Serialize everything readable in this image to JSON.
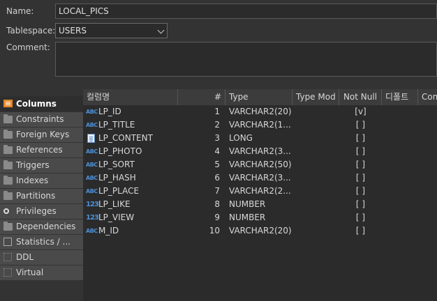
{
  "form": {
    "name_label": "Name:",
    "name_value": "LOCAL_PICS",
    "tablespace_label": "Tablespace:",
    "tablespace_value": "USERS",
    "comment_label": "Comment:",
    "comment_value": ""
  },
  "tabs": [
    {
      "label": "Columns",
      "icon": "columns-icon",
      "active": true
    },
    {
      "label": "Constraints",
      "icon": "constraints-icon"
    },
    {
      "label": "Foreign Keys",
      "icon": "folder-icon"
    },
    {
      "label": "References",
      "icon": "folder-icon"
    },
    {
      "label": "Triggers",
      "icon": "folder-icon"
    },
    {
      "label": "Indexes",
      "icon": "folder-icon"
    },
    {
      "label": "Partitions",
      "icon": "folder-icon"
    },
    {
      "label": "Privileges",
      "icon": "key-icon"
    },
    {
      "label": "Dependencies",
      "icon": "folder-icon"
    },
    {
      "label": "Statistics / ...",
      "icon": "info-icon"
    },
    {
      "label": "DDL",
      "icon": "ddl-icon"
    },
    {
      "label": "Virtual",
      "icon": "virtual-icon"
    }
  ],
  "grid": {
    "headers": {
      "name": "컬럼명",
      "num": "#",
      "type": "Type",
      "type_mod": "Type Mod",
      "not_null": "Not Null",
      "default": "디폴트",
      "comment": "Com"
    },
    "rows": [
      {
        "icon": "ABC",
        "name": "LP_ID",
        "num": "1",
        "type": "VARCHAR2(20)",
        "not_null": "[v]"
      },
      {
        "icon": "ABC",
        "name": "LP_TITLE",
        "num": "2",
        "type": "VARCHAR2(1...",
        "not_null": "[ ]"
      },
      {
        "icon": "LOB",
        "name": "LP_CONTENT",
        "num": "3",
        "type": "LONG",
        "not_null": "[ ]"
      },
      {
        "icon": "ABC",
        "name": "LP_PHOTO",
        "num": "4",
        "type": "VARCHAR2(3...",
        "not_null": "[ ]"
      },
      {
        "icon": "ABC",
        "name": "LP_SORT",
        "num": "5",
        "type": "VARCHAR2(50)",
        "not_null": "[ ]"
      },
      {
        "icon": "ABC",
        "name": "LP_HASH",
        "num": "6",
        "type": "VARCHAR2(3...",
        "not_null": "[ ]"
      },
      {
        "icon": "ABC",
        "name": "LP_PLACE",
        "num": "7",
        "type": "VARCHAR2(2...",
        "not_null": "[ ]"
      },
      {
        "icon": "123",
        "name": "LP_LIKE",
        "num": "8",
        "type": "NUMBER",
        "not_null": "[ ]"
      },
      {
        "icon": "123",
        "name": "LP_VIEW",
        "num": "9",
        "type": "NUMBER",
        "not_null": "[ ]"
      },
      {
        "icon": "ABC",
        "name": "M_ID",
        "num": "10",
        "type": "VARCHAR2(20)",
        "not_null": "[ ]"
      }
    ]
  }
}
